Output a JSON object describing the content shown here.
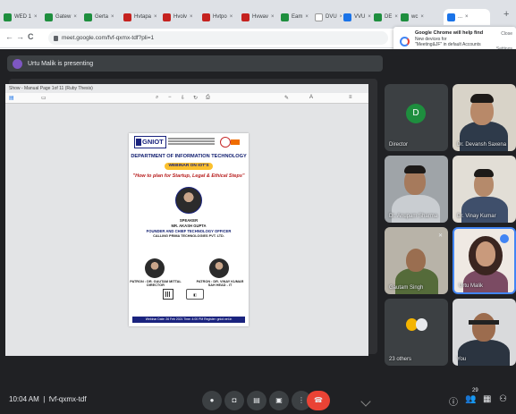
{
  "browser": {
    "tabs": [
      {
        "label": "WED 1",
        "color": "#1e8e3e"
      },
      {
        "label": "Gatew",
        "color": "#1e8e3e"
      },
      {
        "label": "Gerta",
        "color": "#1e8e3e"
      },
      {
        "label": "Hvtapa",
        "color": "#c5221f"
      },
      {
        "label": "Hvolv",
        "color": "#c5221f"
      },
      {
        "label": "Hvtpo",
        "color": "#c5221f"
      },
      {
        "label": "Hvwav",
        "color": "#c5221f"
      },
      {
        "label": "Eam",
        "color": "#1e8e3e"
      },
      {
        "label": "DVU",
        "color": "#ffffff"
      },
      {
        "label": "VVU",
        "color": "#1a73e8"
      },
      {
        "label": "DE",
        "color": "#1e8e3e"
      },
      {
        "label": "wc",
        "color": "#1e8e3e"
      },
      {
        "label": "...",
        "color": "#1a73e8"
      }
    ],
    "new_tab": "+",
    "url": "meet.google.com/fvf-qxmx-tdf?pli=1"
  },
  "notification": {
    "title": "Google Chrome will help find",
    "line1": "New devices for",
    "line2": "\"Meeting&JF\" in default Accounts",
    "btn_close": "Close",
    "btn_settings": "Settings"
  },
  "meet": {
    "presenting_label": "Urtu Malik is presenting",
    "doc_title": "Show - Manual Page 1of 11 (Ruby Thesis)",
    "poster": {
      "logo": "GNIOT",
      "department": "DEPARTMENT OF INFORMATION TECHNOLOGY",
      "banner": "WEBINAR ON IOT'S",
      "talk_title": "\"How to plan for Startup, Legal & Ethical Steps\"",
      "speaker_role": "SPEAKER",
      "speaker_name": "MR. AKASH GUPTA",
      "speaker_title": "FOUNDER AND CHIEF TECHNOLOGY OFFICER",
      "speaker_org": "CALLING PRIMA TECHNOLOGIES PVT. LTD.",
      "left_caption": "PATRON : DR. GAUTAM MITTAL\nDIRECTOR",
      "right_caption": "PATRON : DR. VINAY KUMAR SAH\nHEAD - IT",
      "footer": "Webinar Date: 26 Feb 2021  Time: 4:00 PM  Register: gniot.net.in"
    },
    "participants": [
      {
        "name": "Director",
        "kind": "avatar",
        "initial": "D"
      },
      {
        "name": "Dr. Devansh Saxena"
      },
      {
        "name": "Dr. Anupam Sharma"
      },
      {
        "name": "Dr. Vinay Kumar"
      },
      {
        "name": "Gautam Singh"
      },
      {
        "name": "Urtu Malik"
      },
      {
        "name": "23 others",
        "kind": "others"
      },
      {
        "name": "You"
      }
    ],
    "time": "10:04 AM",
    "meeting_code": "fvf-qxmx-tdf",
    "controls": [
      {
        "icon": "mic-icon",
        "glyph": "●"
      },
      {
        "icon": "camera-icon",
        "glyph": "◘"
      },
      {
        "icon": "captions-icon",
        "glyph": "▤"
      },
      {
        "icon": "present-icon",
        "glyph": "▣"
      },
      {
        "icon": "more-icon",
        "glyph": "⋮"
      },
      {
        "icon": "end-call-icon",
        "glyph": "☎"
      }
    ],
    "right_icons": [
      {
        "icon": "info-icon",
        "glyph": "ⓘ"
      },
      {
        "icon": "people-icon",
        "glyph": "👥"
      },
      {
        "icon": "chat-icon",
        "glyph": "▦"
      },
      {
        "icon": "activities-icon",
        "glyph": "⚇"
      }
    ],
    "people_count": "29"
  }
}
